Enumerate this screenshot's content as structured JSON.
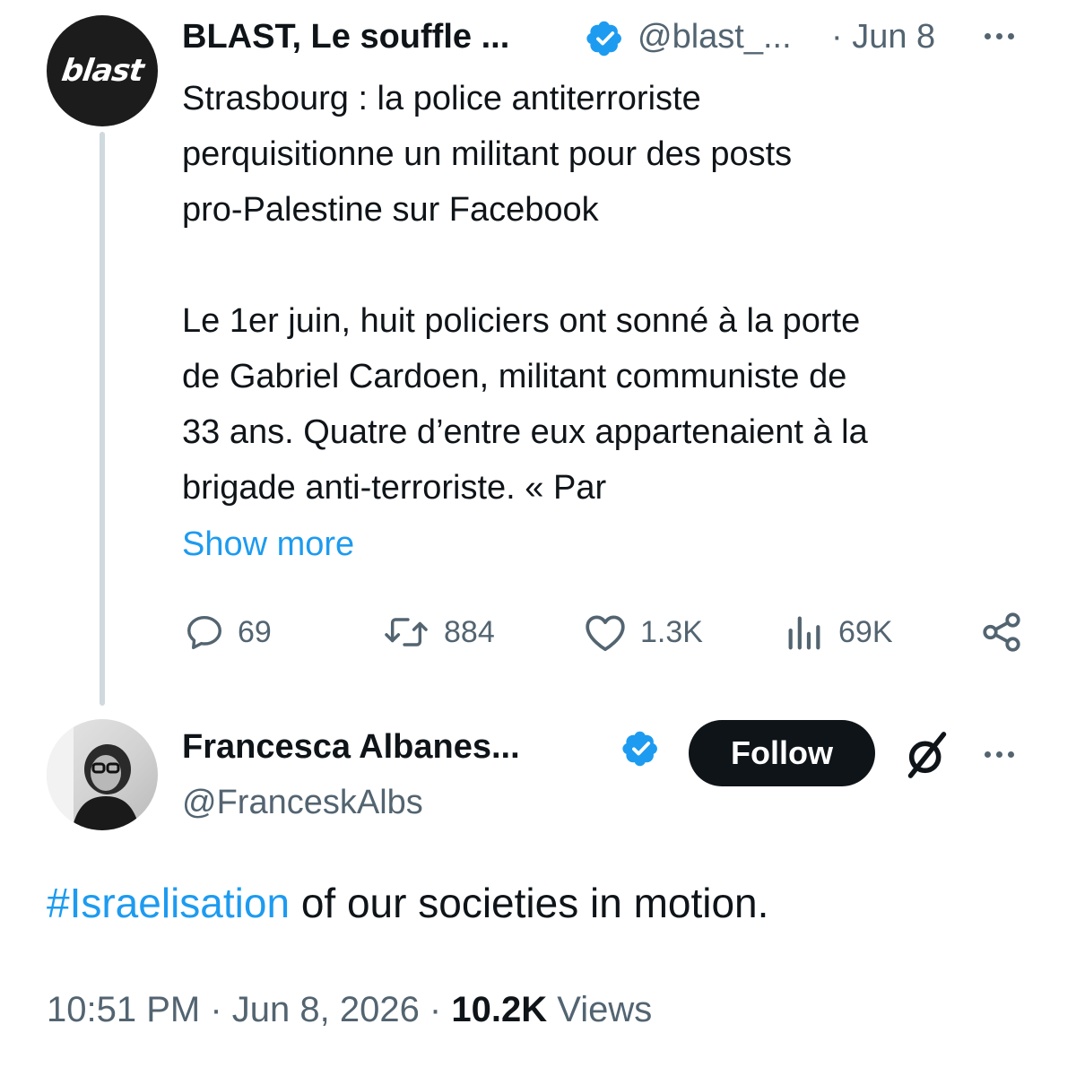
{
  "parent_tweet": {
    "avatar_text": "blast",
    "author_name": "BLAST, Le souffle ...",
    "handle": "@blast_...",
    "date": "· Jun 8",
    "title_lines": [
      "Strasbourg : la police antiterroriste",
      "perquisitionne un militant pour des posts",
      "pro-Palestine sur Facebook"
    ],
    "body_lines": [
      "Le 1er juin, huit policiers ont sonné à la porte",
      "de Gabriel Cardoen,  militant communiste de",
      "33 ans. Quatre d’entre eux appartenaient à la",
      "brigade anti-terroriste. « Par"
    ],
    "show_more": "Show more",
    "actions": {
      "replies": "69",
      "reposts": "884",
      "likes": "1.3K",
      "views": "69K"
    }
  },
  "quote_tweet": {
    "author_name": "Francesca Albanes...",
    "handle": "@FranceskAlbs",
    "follow_label": "Follow",
    "text_hashtag": "#Israelisation",
    "text_rest": " of our societies in motion.",
    "time": "10:51 PM · Jun 8, 2026 · ",
    "views_count": "10.2K",
    "views_label": " Views"
  },
  "colors": {
    "accent": "#1d9bf0",
    "text": "#0f1419",
    "muted": "#536471",
    "thread_line": "#cfd9de"
  },
  "icons": [
    "verified-badge-icon",
    "more-icon",
    "reply-icon",
    "repost-icon",
    "like-icon",
    "views-icon",
    "share-icon",
    "grok-slash-icon"
  ]
}
